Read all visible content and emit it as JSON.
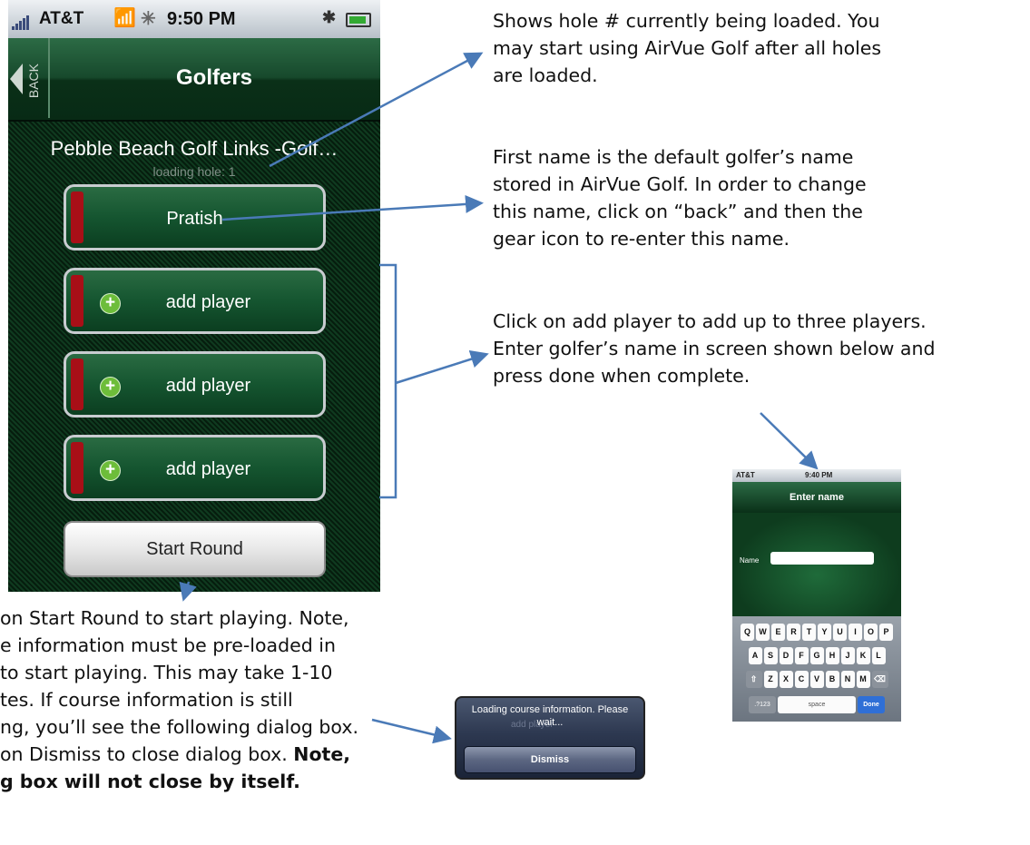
{
  "status_bar": {
    "carrier": "AT&T",
    "time": "9:50 PM"
  },
  "nav": {
    "back_label": "BACK",
    "title": "Golfers"
  },
  "course": {
    "name": "Pebble Beach Golf Links -Golf…",
    "loading": "loading hole: 1"
  },
  "players": [
    {
      "label": "Pratish"
    },
    {
      "label": "add player"
    },
    {
      "label": "add player"
    },
    {
      "label": "add player"
    }
  ],
  "start_round_label": "Start Round",
  "annotations": {
    "hole": [
      "Shows hole # currently being loaded. You",
      "may start using AirVue Golf after all holes",
      "are loaded."
    ],
    "first_name": [
      "First name is the default golfer’s name",
      "stored in AirVue Golf. In order to change",
      "this name, click on “back” and then the",
      "gear icon to re-enter this name."
    ],
    "add_player": [
      "Click on add player to add up to three players.",
      "Enter golfer’s name in screen shown below and",
      "press done when complete."
    ],
    "start_round": {
      "l1": "on Start Round to start playing. Note,",
      "l2": "e information must be pre-loaded in",
      "l3": " to start playing. This may take 1-10",
      "l4": "tes. If course information is still",
      "l5": "ng, you’ll see the following dialog box.",
      "l6a": "on Dismiss to close dialog box. ",
      "l6b": "Note,",
      "l7": "g box will not close by itself."
    }
  },
  "enter_name_screen": {
    "carrier": "AT&T",
    "time": "9:40 PM",
    "title": "Enter name",
    "field_label": "Name",
    "field_value": "",
    "keyboard": {
      "row1": [
        "Q",
        "W",
        "E",
        "R",
        "T",
        "Y",
        "U",
        "I",
        "O",
        "P"
      ],
      "row2": [
        "A",
        "S",
        "D",
        "F",
        "G",
        "H",
        "J",
        "K",
        "L"
      ],
      "row3": [
        "Z",
        "X",
        "C",
        "V",
        "B",
        "N",
        "M"
      ],
      "num_key": ".?123",
      "space_key": "space",
      "done_key": "Done"
    }
  },
  "dialog": {
    "message": "Loading course information.  Please wait...",
    "behind_text": "add player",
    "dismiss_label": "Dismiss"
  },
  "colors": {
    "nav_green": "#17492c",
    "player_red_bar": "#a80f17",
    "arrow_blue": "#4a7ab7"
  }
}
